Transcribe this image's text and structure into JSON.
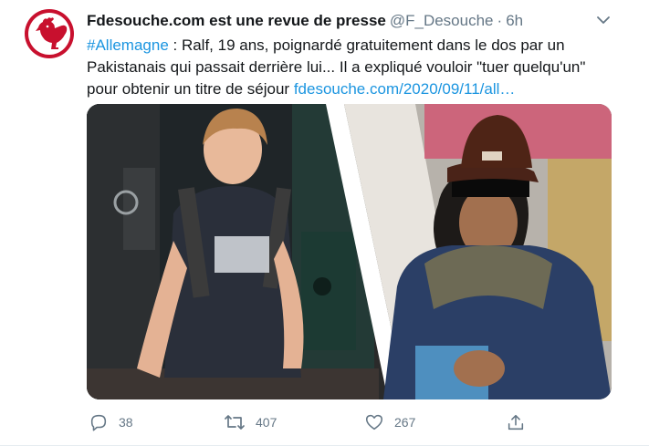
{
  "tweet": {
    "display_name": "Fdesouche.com est une revue de presse",
    "handle": "@F_Desouche",
    "separator": "·",
    "time": "6h",
    "hashtag": "#Allemagne",
    "text_line1": " : Ralf, 19 ans, poignardé gratuitement dans le dos par un",
    "text_line2": "Pakistanais qui passait derrière lui... Il a expliqué vouloir \"tuer quelqu'un\"",
    "text_line3": "pour obtenir un titre de séjour ",
    "link": "fdesouche.com/2020/09/11/all…"
  },
  "actions": {
    "replies": "38",
    "retweets": "407",
    "likes": "267"
  },
  "colors": {
    "brand_red": "#c8102e",
    "link_blue": "#1b95e0",
    "muted_gray": "#657786"
  },
  "icons": [
    "rooster-logo-icon",
    "chevron-down-icon",
    "reply-icon",
    "retweet-icon",
    "like-icon",
    "share-icon"
  ]
}
